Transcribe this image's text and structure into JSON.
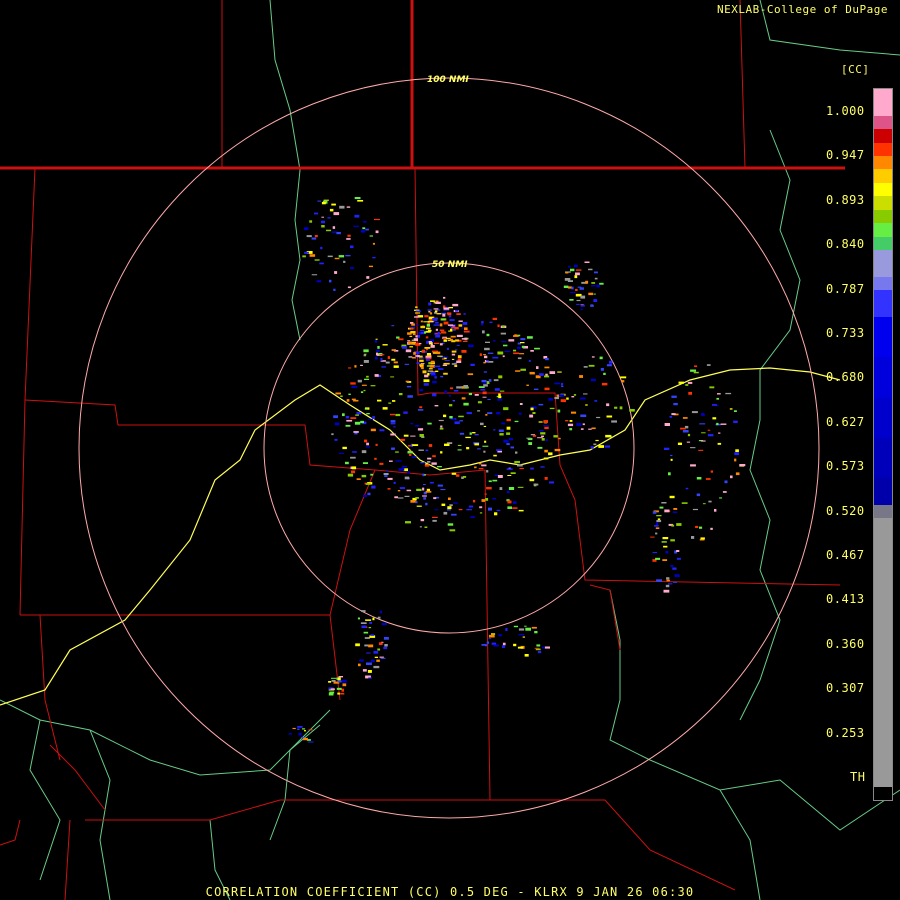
{
  "header": {
    "credit": "NEXLAB-College of DuPage",
    "product_code": "[CC]",
    "bottom_title": "CORRELATION COEFFICIENT (CC) 0.5 DEG - KLRX 9 JAN 26 06:30"
  },
  "rings": [
    {
      "label": "100 NMI"
    },
    {
      "label": "50 NMI"
    }
  ],
  "scale": {
    "ticks": [
      "1.000",
      "0.947",
      "0.893",
      "0.840",
      "0.787",
      "0.733",
      "0.680",
      "0.627",
      "0.573",
      "0.520",
      "0.467",
      "0.413",
      "0.360",
      "0.307",
      "0.253",
      "TH"
    ]
  },
  "colors": {
    "background": "#000000",
    "borders": "#cc1111",
    "rivers": "#66cc88",
    "highway": "#ffff55",
    "rings": "#ffaaaa",
    "text": "#ffff66"
  }
}
